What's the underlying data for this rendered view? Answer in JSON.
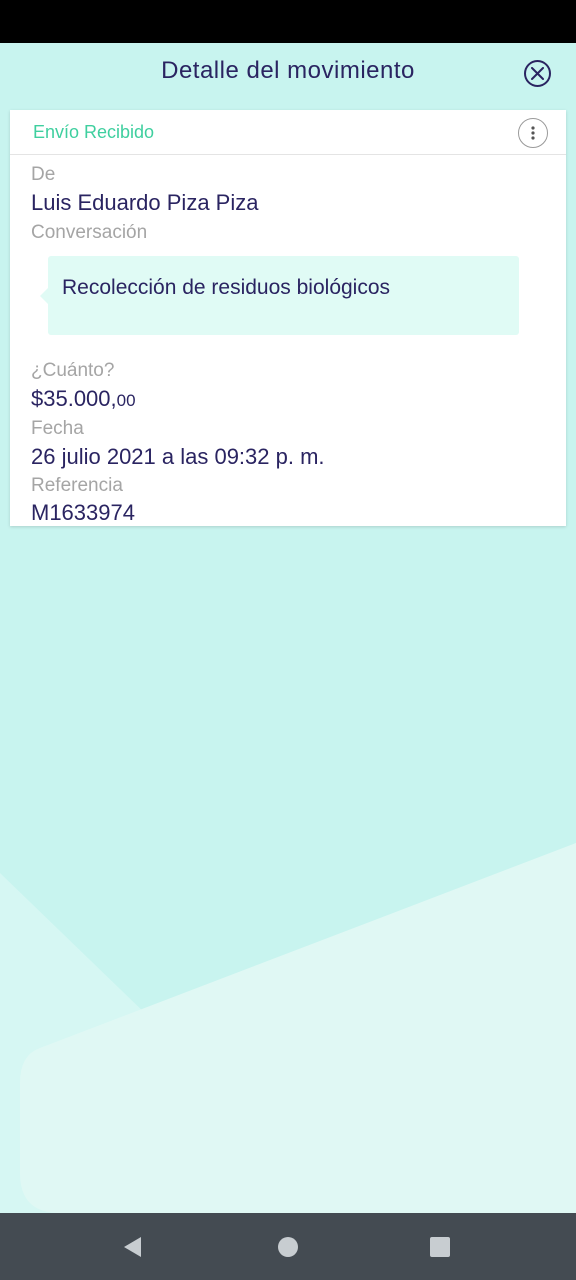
{
  "header": {
    "title": "Detalle del movimiento",
    "close_icon": "close-circle-icon"
  },
  "card": {
    "title": "Envío Recibido",
    "more_icon": "more-vertical-icon",
    "from_label": "De",
    "from_value": "Luis Eduardo Piza Piza",
    "conversation_label": "Conversación",
    "conversation_message": "Recolección de residuos biológicos",
    "amount_label": "¿Cuánto?",
    "amount_main": "$35.000,",
    "amount_cents": "00",
    "date_label": "Fecha",
    "date_value": "26 julio 2021 a las 09:32 p. m.",
    "reference_label": "Referencia",
    "reference_value": "M1633974"
  },
  "nav": {
    "back_icon": "back-triangle-icon",
    "home_icon": "home-circle-icon",
    "recents_icon": "recents-square-icon"
  },
  "colors": {
    "background": "#c8f4ef",
    "accent_green": "#3fcf9f",
    "text_primary": "#2a2461",
    "bubble": "#e0fbf5"
  }
}
